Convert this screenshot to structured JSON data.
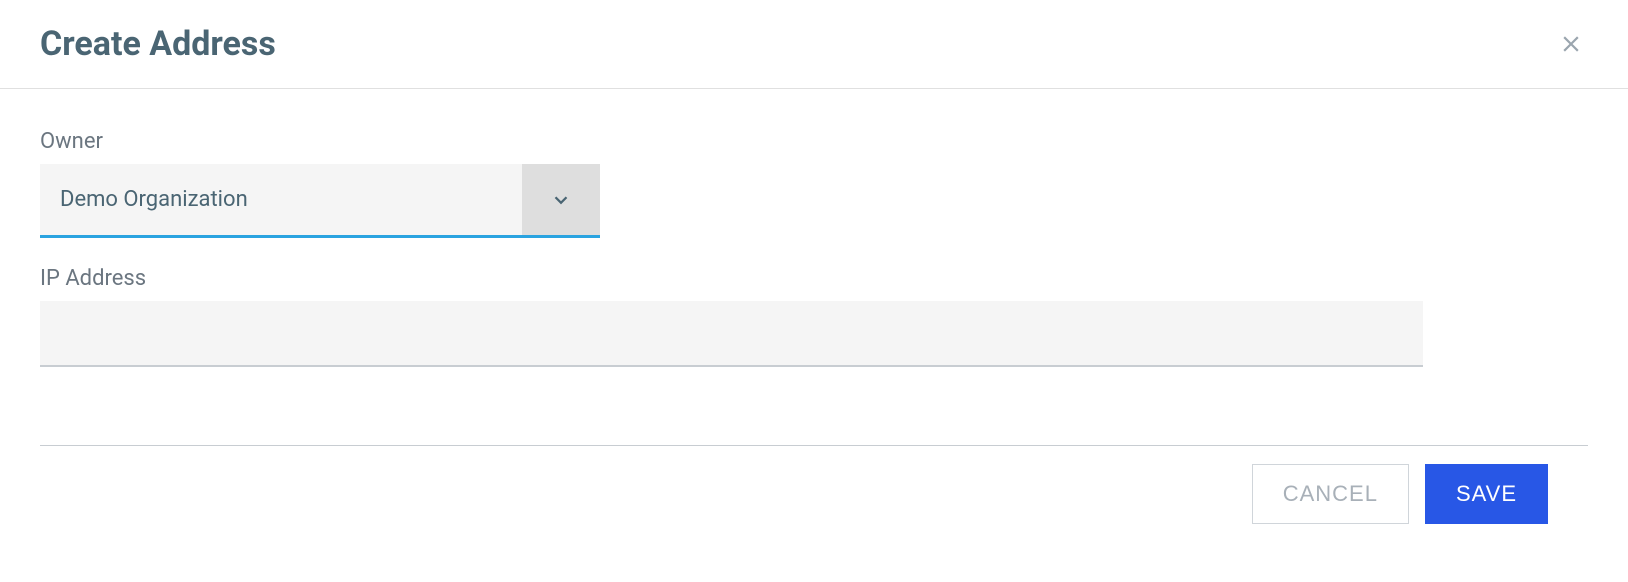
{
  "header": {
    "title": "Create Address"
  },
  "form": {
    "owner": {
      "label": "Owner",
      "value": "Demo Organization"
    },
    "ip_address": {
      "label": "IP Address",
      "value": ""
    }
  },
  "footer": {
    "cancel_label": "CANCEL",
    "save_label": "SAVE"
  }
}
